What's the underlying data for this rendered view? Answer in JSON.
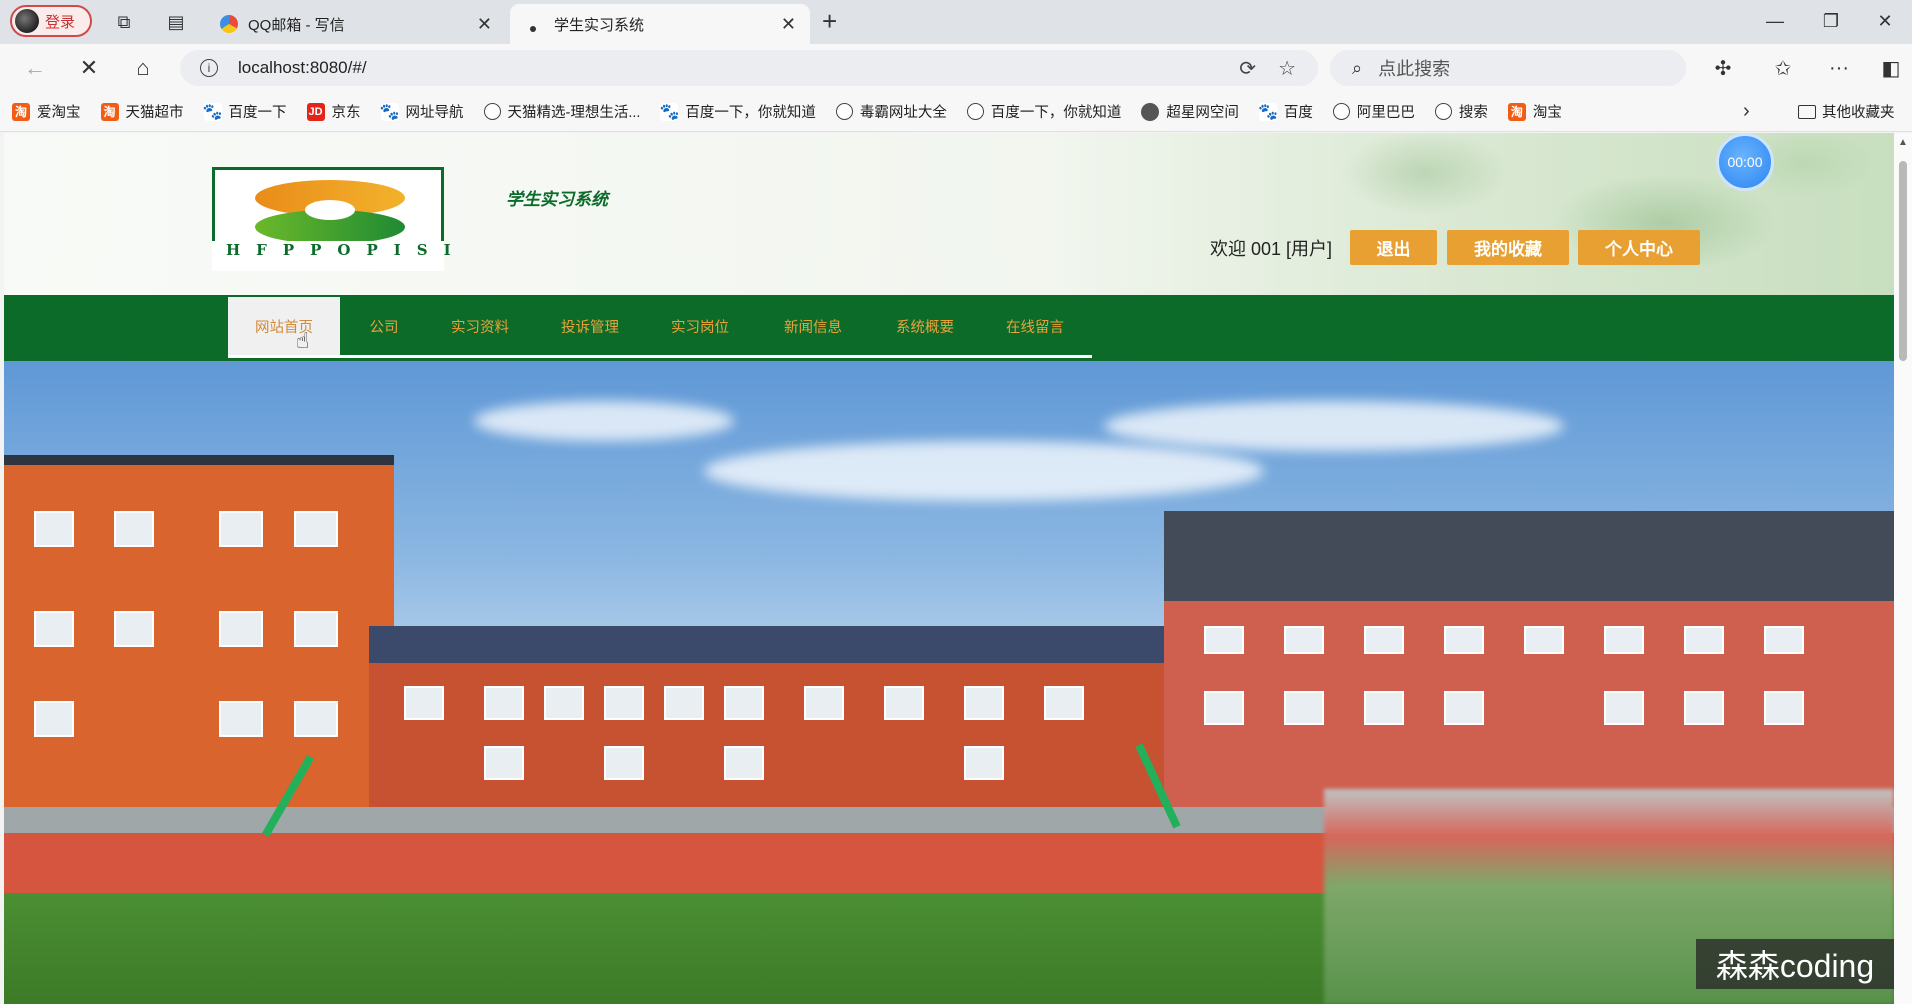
{
  "browser": {
    "profile_label": "登录",
    "tabs": [
      {
        "title": "QQ邮箱 - 写信",
        "active": false
      },
      {
        "title": "学生实习系统",
        "active": true
      }
    ],
    "url": "localhost:8080/#/",
    "search_placeholder": "点此搜索",
    "bookmarks": [
      {
        "label": "爱淘宝",
        "icon": "taobao-icon"
      },
      {
        "label": "天猫超市",
        "icon": "taobao-icon"
      },
      {
        "label": "百度一下",
        "icon": "baidu-paw-icon"
      },
      {
        "label": "京东",
        "icon": "jd-icon"
      },
      {
        "label": "网址导航",
        "icon": "baidu-paw-icon"
      },
      {
        "label": "天猫精选-理想生活...",
        "icon": "globe-icon"
      },
      {
        "label": "百度一下，你就知道",
        "icon": "baidu-paw-icon"
      },
      {
        "label": "毒霸网址大全",
        "icon": "globe-icon"
      },
      {
        "label": "百度一下，你就知道",
        "icon": "globe-icon"
      },
      {
        "label": "超星网空间",
        "icon": "star-icon"
      },
      {
        "label": "百度",
        "icon": "baidu-paw-icon"
      },
      {
        "label": "阿里巴巴",
        "icon": "globe-icon"
      },
      {
        "label": "搜索",
        "icon": "globe-icon"
      },
      {
        "label": "淘宝",
        "icon": "taobao-icon"
      }
    ],
    "other_bookmarks": "其他收藏夹"
  },
  "site": {
    "logo_text": "HFPPOPISI",
    "title": "学生实习系统",
    "welcome": "欢迎 001 [用户]",
    "buttons": {
      "logout": "退出",
      "favorites": "我的收藏",
      "profile": "个人中心"
    },
    "timer": "00:00",
    "nav": [
      {
        "label": "网站首页",
        "active": true
      },
      {
        "label": "公司",
        "active": false
      },
      {
        "label": "实习资料",
        "active": false
      },
      {
        "label": "投诉管理",
        "active": false
      },
      {
        "label": "实习岗位",
        "active": false
      },
      {
        "label": "新闻信息",
        "active": false
      },
      {
        "label": "系统概要",
        "active": false
      },
      {
        "label": "在线留言",
        "active": false
      }
    ]
  },
  "watermark": "森森coding",
  "colors": {
    "brand_green": "#0d6b2a",
    "nav_text": "#e9a23b",
    "button_orange": "#e8a033"
  }
}
